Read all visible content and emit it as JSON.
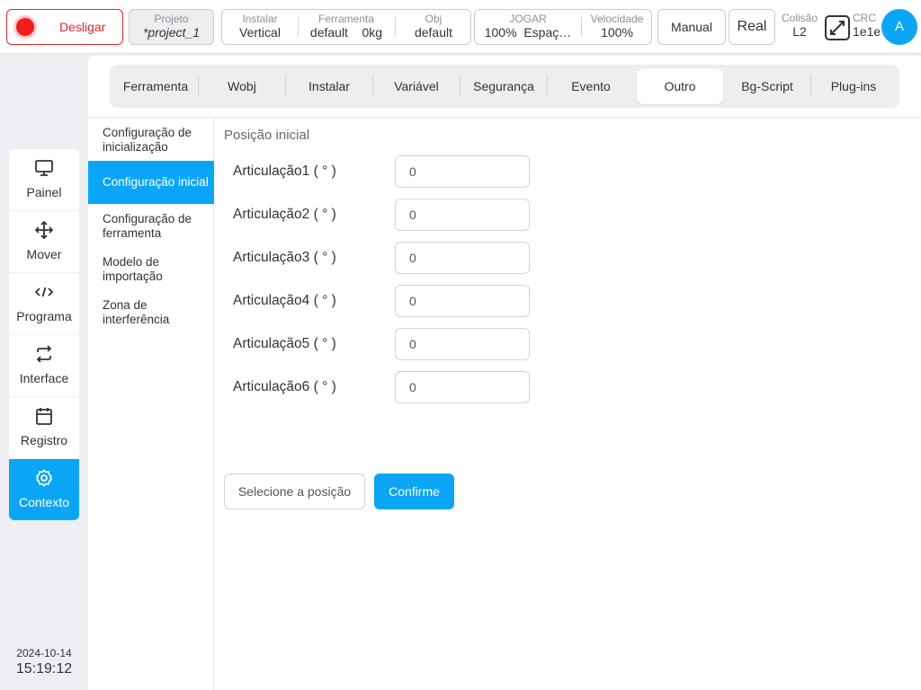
{
  "topbar": {
    "power_label": "Desligar",
    "project": {
      "label": "Projeto",
      "value": "*project_1"
    },
    "install": {
      "label": "Instalar",
      "value": "Vertical"
    },
    "tool": {
      "label": "Ferramenta",
      "value": "default",
      "weight": "0kg"
    },
    "obj": {
      "label": "Obj",
      "value": "default"
    },
    "jog": {
      "label": "JOGAR",
      "value": "100%",
      "space": "Espaç…"
    },
    "speed": {
      "label": "Velocidade",
      "value": "100%"
    },
    "mode_button": "Manual",
    "real_button": "Real",
    "collision": {
      "label": "Colisão",
      "value": "L2"
    },
    "crc": {
      "label": "CRC",
      "value": "1e1e"
    },
    "avatar": "A"
  },
  "leftnav": {
    "items": [
      {
        "label": "Painel",
        "icon": "monitor-icon"
      },
      {
        "label": "Mover",
        "icon": "move-icon"
      },
      {
        "label": "Programa",
        "icon": "code-icon"
      },
      {
        "label": "Interface",
        "icon": "swap-icon"
      },
      {
        "label": "Registro",
        "icon": "calendar-icon"
      },
      {
        "label": "Contexto",
        "icon": "gear-icon",
        "active": true
      }
    ]
  },
  "datetime": {
    "date": "2024-10-14",
    "time": "15:19:12"
  },
  "tabs": [
    {
      "label": "Ferramenta"
    },
    {
      "label": "Wobj"
    },
    {
      "label": "Instalar"
    },
    {
      "label": "Variável"
    },
    {
      "label": "Segurança"
    },
    {
      "label": "Evento"
    },
    {
      "label": "Outro",
      "active": true
    },
    {
      "label": "Bg-Script"
    },
    {
      "label": "Plug-ins"
    }
  ],
  "subnav": [
    {
      "label": "Configuração de inicialização"
    },
    {
      "label": "Configuração inicial",
      "active": true
    },
    {
      "label": "Configuração de ferramenta"
    },
    {
      "label": "Modelo de importação"
    },
    {
      "label": "Zona de interferência"
    }
  ],
  "content": {
    "title": "Posição inicial",
    "joints": [
      {
        "label": "Articulação1 ( ° )",
        "value": "0"
      },
      {
        "label": "Articulação2 ( ° )",
        "value": "0"
      },
      {
        "label": "Articulação3 ( ° )",
        "value": "0"
      },
      {
        "label": "Articulação4 ( ° )",
        "value": "0"
      },
      {
        "label": "Articulação5 ( ° )",
        "value": "0"
      },
      {
        "label": "Articulação6 ( ° )",
        "value": "0"
      }
    ],
    "select_button": "Selecione a posição",
    "confirm_button": "Confirme"
  },
  "colors": {
    "accent": "#0aa6f5",
    "danger": "#e0282d"
  }
}
